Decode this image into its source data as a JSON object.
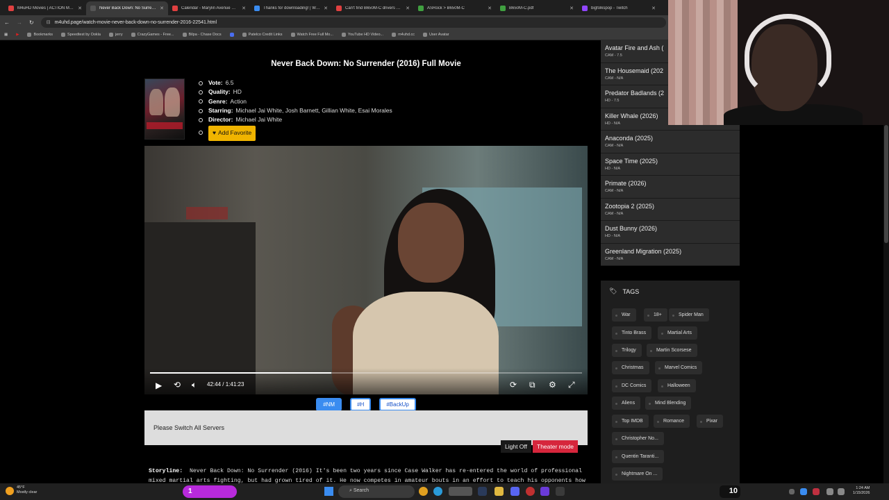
{
  "browser": {
    "tabs": [
      {
        "label": "M4uHD Movies | ACTION Movi",
        "color": "#e04040",
        "active": false
      },
      {
        "label": "Never Back Down: No Surrende",
        "color": "#555555",
        "active": true
      },
      {
        "label": "Calendar - Marylin Avenue STE",
        "color": "#e04040",
        "active": false
      },
      {
        "label": "Thanks for downloading! | Wea",
        "color": "#3a8cf0",
        "active": false
      },
      {
        "label": "Can't find B650M-C drivers or ve",
        "color": "#e04040",
        "active": false
      },
      {
        "label": "ASRock > B650M-C",
        "color": "#40a040",
        "active": false
      },
      {
        "label": "B650M-C.pdf",
        "color": "#40a040",
        "active": false
      },
      {
        "label": "bigfolkspop - Twitch",
        "color": "#9146ff",
        "active": false
      }
    ],
    "url": "m4uhd.page/watch-movie-never-back-down-no-surrender-2016-22541.html",
    "bookmarks": [
      "Bookmarks",
      "Speedtest by Ookla",
      "jerry",
      "CrazyGames - Free...",
      "Bilpa - Chase Docs",
      "",
      "Patelco Credit Links",
      "Watch Free Full Mo...",
      "YouTube HD Video...",
      "m4uhd.cc",
      "User Avatar"
    ]
  },
  "movie": {
    "title": "Never Back Down: No Surrender (2016) Full Movie",
    "vote_label": "Vote:",
    "vote": "6.5",
    "quality_label": "Quality:",
    "quality": "HD",
    "genre_label": "Genre:",
    "genre": "Action",
    "starring_label": "Starring:",
    "starring": "Michael Jai White, Josh Barnett, Gillian White, Esai Morales",
    "director_label": "Director:",
    "director": "Michael Jai White",
    "add_favorite": "Add Favorite"
  },
  "player": {
    "current_time": "42:44",
    "separator": "/",
    "duration": "1:41:23",
    "progress": 0.42
  },
  "servers": [
    {
      "label": "#NM",
      "selected": true
    },
    {
      "label": "#H",
      "selected": false
    },
    {
      "label": "#BackUp",
      "selected": false
    }
  ],
  "notice": "Please Switch All Servers",
  "buttons": {
    "light_off": "Light Off",
    "theater_mode": "Theater mode"
  },
  "storyline": {
    "label": "Storyline:",
    "text": "Never Back Down: No Surrender (2016) It's been two years since Case Walker has re-entered the world of professional mixed martial arts fighting, but had grown tired of it. He now competes in amateur bouts in an effort to teach his opponents how"
  },
  "sidebar": {
    "movies": [
      {
        "title": "Avatar Fire and Ash (",
        "sub": "CAM - 7.5"
      },
      {
        "title": "The Housemaid (202",
        "sub": "CAM - N/A"
      },
      {
        "title": "Predator Badlands (2",
        "sub": "HD - 7.5"
      },
      {
        "title": "Killer Whale (2026)",
        "sub": "HD - N/A"
      },
      {
        "title": "Anaconda (2025)",
        "sub": "CAM - N/A"
      },
      {
        "title": "Space Time (2025)",
        "sub": "HD - N/A"
      },
      {
        "title": "Primate (2026)",
        "sub": "CAM - N/A"
      },
      {
        "title": "Zootopia 2 (2025)",
        "sub": "CAM - N/A"
      },
      {
        "title": "Dust Bunny (2026)",
        "sub": "HD - N/A"
      },
      {
        "title": "Greenland Migration (2025)",
        "sub": "CAM - N/A"
      }
    ],
    "tags_heading": "TAGS",
    "tags": [
      "War",
      "18+",
      "Spider Man",
      "Tinto Brass",
      "Martial Arts",
      "Trilogy",
      "Martin Scorsese",
      "Christmas",
      "Marvel Comics",
      "DC Comics",
      "Halloween",
      "Aliens",
      "Mind Blending",
      "Top IMDB",
      "Romance",
      "Pixar",
      "Christopher No...",
      "Quentin Taranti...",
      "Nightmare On ..."
    ]
  },
  "taskbar": {
    "weather_temp": "45°F",
    "weather_desc": "Mostly clear",
    "badge_left": "1",
    "search": "Search",
    "badge_right": "10",
    "time": "1:24 AM",
    "date": "1/15/2026"
  }
}
